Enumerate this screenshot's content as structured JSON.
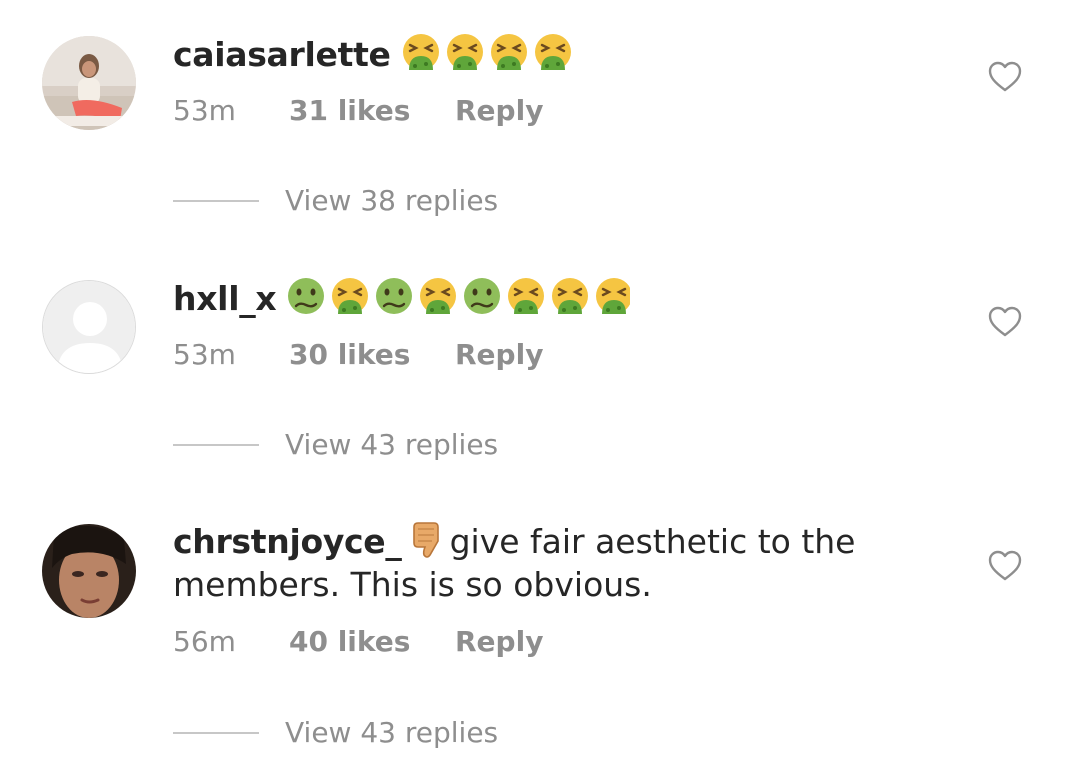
{
  "comments": [
    {
      "username": "caiasarlette",
      "text": "",
      "emojis": [
        "nauseated-vomit",
        "nauseated-vomit",
        "nauseated-vomit",
        "nauseated-vomit"
      ],
      "time": "53m",
      "likes": "31 likes",
      "reply": "Reply",
      "view_replies": "View 38 replies",
      "avatar": "photo-woman-sitting"
    },
    {
      "username": "hxll_x",
      "text": "",
      "emojis": [
        "nauseated",
        "vomit",
        "nauseated",
        "vomit",
        "nauseated",
        "vomit",
        "vomit",
        "vomit"
      ],
      "time": "53m",
      "likes": "30 likes",
      "reply": "Reply",
      "view_replies": "View 43 replies",
      "avatar": "default-avatar"
    },
    {
      "username": "chrstnjoyce_",
      "text_line1": "give fair aesthetic to the",
      "text_line2": "members. This is so obvious.",
      "emojis": [
        "thumbs-down"
      ],
      "time": "56m",
      "likes": "40 likes",
      "reply": "Reply",
      "view_replies": "View 43 replies",
      "avatar": "photo-face-closeup"
    }
  ],
  "colors": {
    "text": "#262626",
    "secondary": "#8e8e8e",
    "divider": "#c7c7c7",
    "emoji_yellow": "#f5c542",
    "emoji_green": "#5fa63a"
  }
}
